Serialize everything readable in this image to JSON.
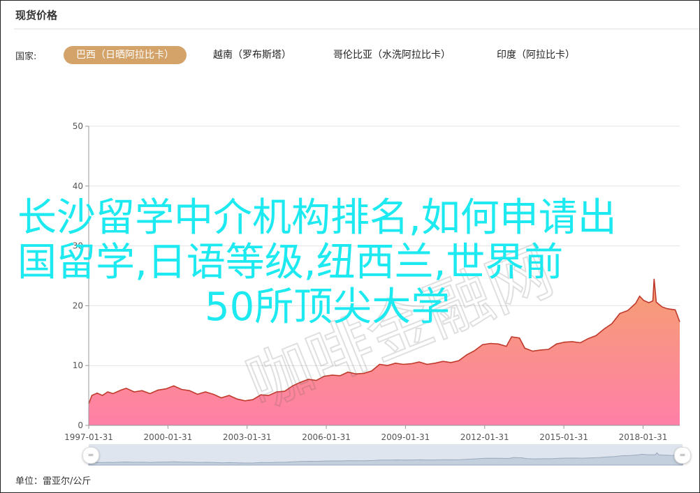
{
  "panel": {
    "title": "现货价格",
    "country_label": "国家:",
    "tabs": [
      {
        "label": "巴西（日晒阿拉比卡）",
        "active": true
      },
      {
        "label": "越南（罗布斯塔）",
        "active": false
      },
      {
        "label": "哥伦比亚（水洗阿拉比卡）",
        "active": false
      },
      {
        "label": "印度（阿拉比卡）",
        "active": false
      }
    ],
    "unit_label": "单位：雷亚尔/公斤"
  },
  "overlay": {
    "line1": "长沙留学中介机构排名,如何申请出",
    "line2": "国留学,日语等级,纽西兰,世界前",
    "line3": "50所顶尖大学",
    "color": "#1de9f0"
  },
  "watermark": {
    "text": "咖啡金融网"
  },
  "chart_data": {
    "type": "area",
    "title": "",
    "xlabel": "",
    "ylabel": "",
    "ylim": [
      0,
      50
    ],
    "yticks": [
      0,
      10,
      20,
      30,
      40,
      50
    ],
    "xlim": [
      1997.08,
      2019.47
    ],
    "xticks": [
      {
        "value": 1997.08,
        "label": "1997-01-31"
      },
      {
        "value": 2000.08,
        "label": "2000-01-31"
      },
      {
        "value": 2003.08,
        "label": "2003-01-31"
      },
      {
        "value": 2006.08,
        "label": "2006-01-31"
      },
      {
        "value": 2009.08,
        "label": "2009-01-31"
      },
      {
        "value": 2012.08,
        "label": "2012-01-31"
      },
      {
        "value": 2015.08,
        "label": "2015-01-31"
      },
      {
        "value": 2018.08,
        "label": "2018-01-31"
      }
    ],
    "grid": true,
    "series": [
      {
        "line_color": "#c0392b",
        "fill_top": "#f5a070",
        "fill_bottom": "#ff7fa8",
        "points": [
          [
            1997.08,
            3.6
          ],
          [
            1997.2,
            5.0
          ],
          [
            1997.4,
            5.4
          ],
          [
            1997.6,
            5.0
          ],
          [
            1997.8,
            5.6
          ],
          [
            1998.0,
            5.3
          ],
          [
            1998.3,
            5.9
          ],
          [
            1998.5,
            6.2
          ],
          [
            1998.8,
            5.6
          ],
          [
            1999.1,
            5.8
          ],
          [
            1999.4,
            5.3
          ],
          [
            1999.7,
            5.9
          ],
          [
            2000.0,
            6.1
          ],
          [
            2000.3,
            6.6
          ],
          [
            2000.6,
            6.0
          ],
          [
            2000.9,
            5.8
          ],
          [
            2001.2,
            5.2
          ],
          [
            2001.5,
            5.6
          ],
          [
            2001.8,
            5.2
          ],
          [
            2002.1,
            4.6
          ],
          [
            2002.4,
            5.0
          ],
          [
            2002.7,
            4.4
          ],
          [
            2003.0,
            4.1
          ],
          [
            2003.3,
            4.3
          ],
          [
            2003.6,
            5.1
          ],
          [
            2003.9,
            5.0
          ],
          [
            2004.2,
            5.6
          ],
          [
            2004.5,
            5.7
          ],
          [
            2004.8,
            6.6
          ],
          [
            2005.1,
            7.2
          ],
          [
            2005.4,
            7.7
          ],
          [
            2005.7,
            7.5
          ],
          [
            2006.0,
            8.2
          ],
          [
            2006.3,
            8.4
          ],
          [
            2006.6,
            8.3
          ],
          [
            2006.9,
            8.9
          ],
          [
            2007.2,
            8.6
          ],
          [
            2007.5,
            8.7
          ],
          [
            2007.8,
            9.1
          ],
          [
            2008.1,
            10.2
          ],
          [
            2008.4,
            10.0
          ],
          [
            2008.7,
            10.4
          ],
          [
            2009.0,
            10.2
          ],
          [
            2009.3,
            10.3
          ],
          [
            2009.6,
            10.6
          ],
          [
            2009.9,
            10.2
          ],
          [
            2010.2,
            10.4
          ],
          [
            2010.5,
            10.7
          ],
          [
            2010.8,
            10.5
          ],
          [
            2011.1,
            10.8
          ],
          [
            2011.4,
            11.8
          ],
          [
            2011.7,
            12.5
          ],
          [
            2012.0,
            13.5
          ],
          [
            2012.3,
            13.7
          ],
          [
            2012.6,
            13.6
          ],
          [
            2012.9,
            13.2
          ],
          [
            2013.1,
            14.8
          ],
          [
            2013.4,
            14.6
          ],
          [
            2013.6,
            12.9
          ],
          [
            2013.9,
            12.4
          ],
          [
            2014.2,
            12.6
          ],
          [
            2014.5,
            12.7
          ],
          [
            2014.8,
            13.6
          ],
          [
            2015.1,
            13.9
          ],
          [
            2015.4,
            14.0
          ],
          [
            2015.7,
            13.8
          ],
          [
            2016.0,
            14.5
          ],
          [
            2016.3,
            15.0
          ],
          [
            2016.6,
            16.1
          ],
          [
            2016.9,
            17.0
          ],
          [
            2017.2,
            18.7
          ],
          [
            2017.5,
            19.2
          ],
          [
            2017.8,
            20.4
          ],
          [
            2017.95,
            21.6
          ],
          [
            2018.1,
            20.9
          ],
          [
            2018.3,
            20.5
          ],
          [
            2018.45,
            20.8
          ],
          [
            2018.5,
            24.5
          ],
          [
            2018.58,
            20.6
          ],
          [
            2018.8,
            19.8
          ],
          [
            2019.0,
            19.5
          ],
          [
            2019.3,
            19.3
          ],
          [
            2019.47,
            17.3
          ]
        ]
      }
    ]
  }
}
